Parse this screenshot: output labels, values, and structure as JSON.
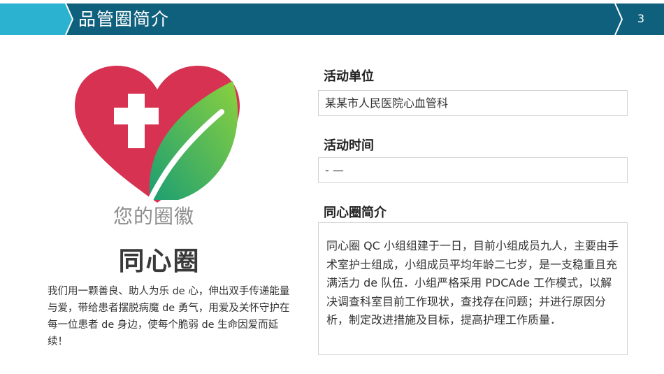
{
  "header": {
    "title": "品管圈简介",
    "page_number": "3",
    "colors": {
      "band": "#0f607c",
      "accent": "#2ab2d0"
    }
  },
  "logo": {
    "icon": "heart-cross-leaf-icon",
    "caption": "您的圈徽",
    "colors": {
      "heart": "#d83252",
      "leaf_light": "#8bd13e",
      "leaf_dark": "#1c9e73",
      "cross": "#ffffff"
    }
  },
  "circle": {
    "name": "同心圈",
    "motto": "我们用一颗善良、助人为乐 de 心，伸出双手传递能量与爱，带给患者摆脱病魔 de 勇气，用爱及关怀守护在每一位患者 de 身边，使每个脆弱 de 生命因爱而延续！"
  },
  "fields": {
    "unit": {
      "label": "活动单位",
      "value": "某某市人民医院心血管科"
    },
    "time": {
      "label": "活动时间",
      "value": "- —"
    },
    "intro": {
      "label": "同心圈简介",
      "value": "同心圈 QC 小组组建于一日，目前小组成员九人，主要由手术室护士组成，小组成员平均年龄二七岁，是一支稳重且充满活力 de 队伍．小组严格采用 PDCAde 工作模式，以解决调查科室目前工作现状，查找存在问题；并进行原因分析，制定改进措施及目标，提高护理工作质量．"
    }
  }
}
